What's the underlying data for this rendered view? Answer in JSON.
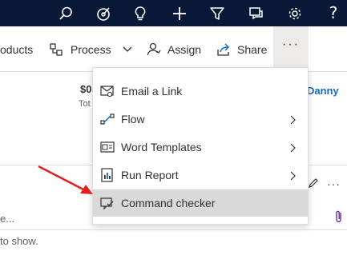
{
  "topnav": {
    "icons": [
      "search-icon",
      "target-icon",
      "lightbulb-icon",
      "plus-icon",
      "filter-icon",
      "chat-icon",
      "gear-icon"
    ],
    "help_label": "?"
  },
  "commandbar": {
    "products_label": "oducts",
    "process_label": "Process",
    "assign_label": "Assign",
    "share_label": "Share",
    "more_label": "···"
  },
  "background": {
    "amount": "$0",
    "amount_caption": "Tot",
    "owner_name": "Danny",
    "input_placeholder": "e...",
    "footer_text": "to show.",
    "more_label": "···"
  },
  "menu": {
    "items": [
      {
        "label": "Email a Link",
        "icon": "email-link-icon",
        "has_submenu": false
      },
      {
        "label": "Flow",
        "icon": "flow-icon",
        "has_submenu": true
      },
      {
        "label": "Word Templates",
        "icon": "word-templates-icon",
        "has_submenu": true
      },
      {
        "label": "Run Report",
        "icon": "report-icon",
        "has_submenu": true
      },
      {
        "label": "Command checker",
        "icon": "command-checker-icon",
        "has_submenu": false,
        "highlighted": true
      }
    ]
  },
  "colors": {
    "nav_bg": "#0a1838",
    "arrow": "#e02020",
    "highlight": "#d9d9d9",
    "link": "#0f6cbd"
  }
}
